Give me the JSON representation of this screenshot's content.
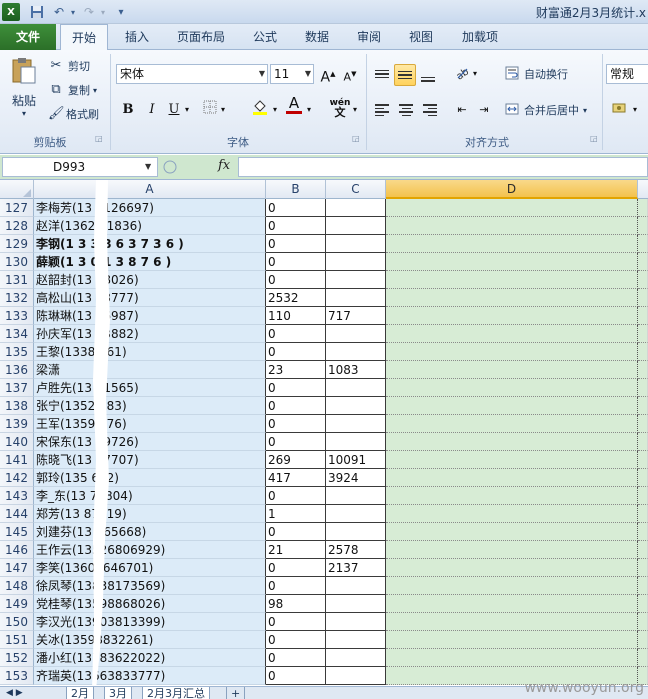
{
  "window": {
    "title": "财富通2月3月统计.x"
  },
  "quick_access": {
    "save_icon": "save-icon",
    "undo_icon": "undo-icon",
    "redo_icon": "redo-icon"
  },
  "tabs": [
    "文件",
    "开始",
    "插入",
    "页面布局",
    "公式",
    "数据",
    "审阅",
    "视图",
    "加载项"
  ],
  "ribbon": {
    "clipboard": {
      "paste": "粘贴",
      "cut": "剪切",
      "copy": "复制",
      "format_painter": "格式刷",
      "group_label": "剪贴板"
    },
    "font": {
      "name": "宋体",
      "size": "11",
      "bold": "B",
      "italic": "I",
      "underline": "U",
      "group_label": "字体",
      "phonetic": "wén",
      "font_color": "#c00000",
      "fill_color": "#ffff00"
    },
    "alignment": {
      "wrap_text": "自动换行",
      "merge_center": "合并后居中",
      "group_label": "对齐方式"
    },
    "number": {
      "format": "常规"
    }
  },
  "formula_bar": {
    "name_box": "D993",
    "fx": "fx",
    "formula": ""
  },
  "columns": [
    "A",
    "B",
    "C",
    "D"
  ],
  "rows": [
    {
      "num": "127",
      "a": "李梅芳(13   7126697)",
      "b": "0",
      "c": ""
    },
    {
      "num": "128",
      "a": "赵洋(1362   21836)",
      "b": "0",
      "c": ""
    },
    {
      "num": "129",
      "a": "李钢(1 3    3 8 6 3 7 3 6 )",
      "b": "0",
      "c": ""
    },
    {
      "num": "130",
      "a": "薛颖(1 3     0 1 3 8 7 6 )",
      "b": "0",
      "c": ""
    },
    {
      "num": "131",
      "a": "赵韶封(13   68026)",
      "b": "0",
      "c": ""
    },
    {
      "num": "132",
      "a": "高松山(13   33777)",
      "b": "2532",
      "c": ""
    },
    {
      "num": "133",
      "a": "陈琳琳(13   76987)",
      "b": "110",
      "c": "717"
    },
    {
      "num": "134",
      "a": "孙庆军(13   33882)",
      "b": "0",
      "c": ""
    },
    {
      "num": "135",
      "a": "王黎(1338   261)",
      "b": "0",
      "c": ""
    },
    {
      "num": "136",
      "a": "梁潇",
      "b": "23",
      "c": "1083"
    },
    {
      "num": "137",
      "a": "卢胜先(13   91565)",
      "b": "0",
      "c": ""
    },
    {
      "num": "138",
      "a": "张宁(1352   183)",
      "b": "0",
      "c": ""
    },
    {
      "num": "139",
      "a": "王军(1359   076)",
      "b": "0",
      "c": ""
    },
    {
      "num": "140",
      "a": "宋保东(13   19726)",
      "b": "0",
      "c": ""
    },
    {
      "num": "141",
      "a": "陈晓飞(13   77707)",
      "b": "269",
      "c": "10091"
    },
    {
      "num": "142",
      "a": "郭玲(135   652)",
      "b": "417",
      "c": "3924"
    },
    {
      "num": "143",
      "a": "李_东(13   75804)",
      "b": "0",
      "c": ""
    },
    {
      "num": "144",
      "a": "郑芳(13   87919)",
      "b": "1",
      "c": ""
    },
    {
      "num": "145",
      "a": "刘建芬(13   865668)",
      "b": "0",
      "c": ""
    },
    {
      "num": "146",
      "a": "王作云(13526806929)",
      "b": "21",
      "c": "2578"
    },
    {
      "num": "147",
      "a": "李笑(13607646701)",
      "b": "0",
      "c": "2137"
    },
    {
      "num": "148",
      "a": "徐凤琴(13838173569)",
      "b": "0",
      "c": ""
    },
    {
      "num": "149",
      "a": "党桂琴(13598868026)",
      "b": "98",
      "c": ""
    },
    {
      "num": "150",
      "a": "李汉光(13903813399)",
      "b": "0",
      "c": ""
    },
    {
      "num": "151",
      "a": "关冰(13598832261)",
      "b": "0",
      "c": ""
    },
    {
      "num": "152",
      "a": "潘小红(13783622022)",
      "b": "0",
      "c": ""
    },
    {
      "num": "153",
      "a": "齐瑞英(13663833777)",
      "b": "0",
      "c": ""
    }
  ],
  "sheet_tabs": [
    "2月",
    "3月",
    "2月3月汇总"
  ],
  "watermark": "www.wooyun.org"
}
